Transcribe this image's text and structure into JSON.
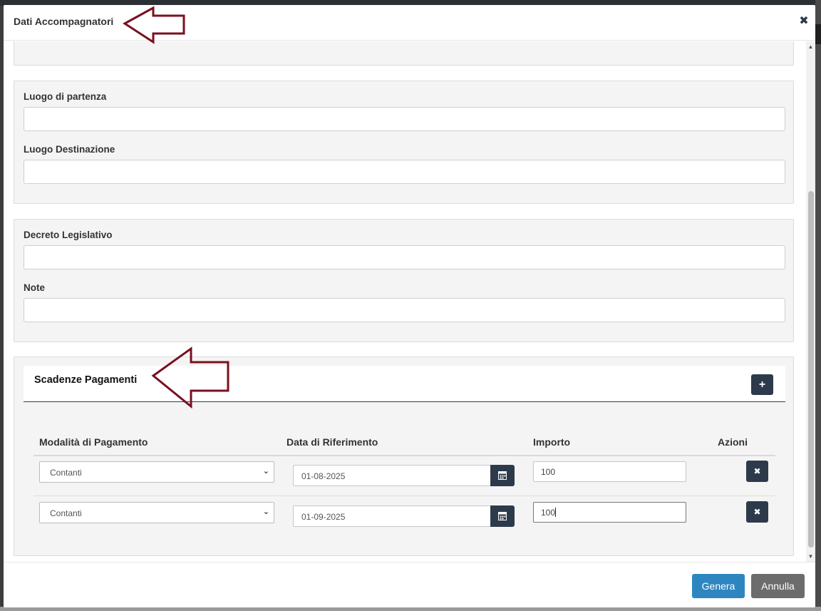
{
  "modal": {
    "title": "Dati Accompagnatori",
    "close_icon": "close-icon"
  },
  "viaggio": {
    "luogo_partenza_label": "Luogo di partenza",
    "luogo_partenza_value": "",
    "luogo_destinazione_label": "Luogo Destinazione",
    "luogo_destinazione_value": ""
  },
  "legale": {
    "decreto_label": "Decreto Legislativo",
    "decreto_value": "",
    "note_label": "Note",
    "note_value": ""
  },
  "scadenze": {
    "title": "Scadenze Pagamenti",
    "add_icon": "plus-icon",
    "columns": [
      "Modalità di Pagamento",
      "Data di Riferimento",
      "Importo",
      "Azioni"
    ],
    "rows": [
      {
        "modalita": "Contanti",
        "data": "01-08-2025",
        "importo": "100"
      },
      {
        "modalita": "Contanti",
        "data": "01-09-2025",
        "importo": "100"
      }
    ]
  },
  "footer": {
    "genera_label": "Genera",
    "annulla_label": "Annulla"
  },
  "colors": {
    "accent_dark": "#2d3a4b",
    "primary_button": "#2e86c1",
    "secondary_button": "#6c6c6c",
    "annotation_arrow": "#7a0f1f"
  }
}
